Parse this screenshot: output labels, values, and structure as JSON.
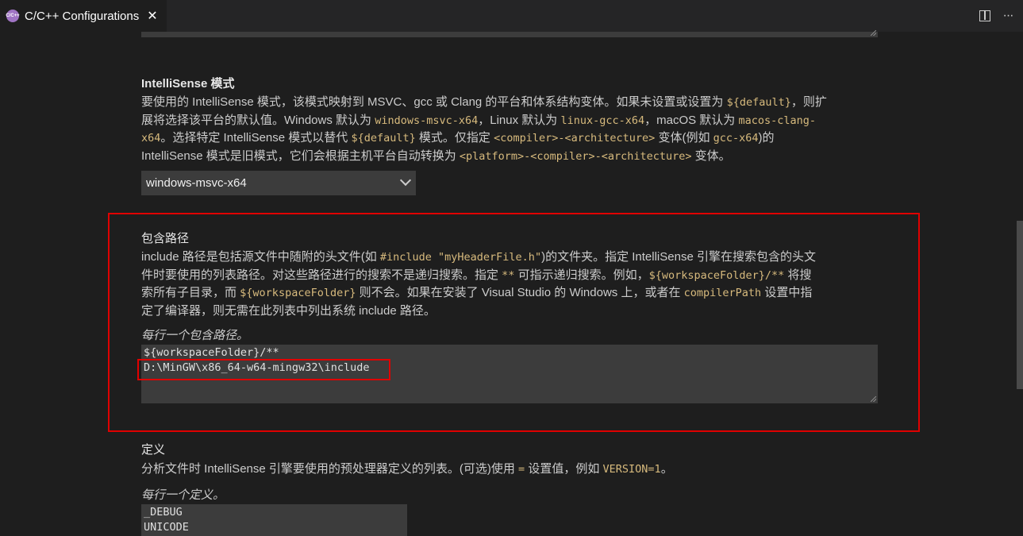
{
  "tab": {
    "title": "C/C++ Configurations",
    "icon": "c-cpp-file-icon",
    "icon_text": "C/C++",
    "close": "✕"
  },
  "toolbar": {
    "split_icon": "split-editor-icon",
    "more": "···"
  },
  "intellisense": {
    "heading": "IntelliSense 模式",
    "desc": [
      [
        {
          "t": "要使用的 IntelliSense 模式，该模式映射到 MSVC、gcc 或 Clang 的平台和体系结构变体。如果未设置或设置为 "
        },
        {
          "c": "${default}"
        },
        {
          "t": "，则扩"
        }
      ],
      [
        {
          "t": "展将选择该平台的默认值。Windows 默认为 "
        },
        {
          "c": "windows-msvc-x64"
        },
        {
          "t": "，Linux 默认为 "
        },
        {
          "c": "linux-gcc-x64"
        },
        {
          "t": "，macOS 默认为 "
        },
        {
          "c": "macos-clang-"
        }
      ],
      [
        {
          "c": "x64"
        },
        {
          "t": "。选择特定 IntelliSense 模式以替代 "
        },
        {
          "c": "${default}"
        },
        {
          "t": " 模式。仅指定 "
        },
        {
          "c": "<compiler>-<architecture>"
        },
        {
          "t": " 变体(例如 "
        },
        {
          "c": "gcc-x64"
        },
        {
          "t": ")的"
        }
      ],
      [
        {
          "t": "IntelliSense 模式是旧模式，它们会根据主机平台自动转换为 "
        },
        {
          "c": "<platform>-<compiler>-<architecture>"
        },
        {
          "t": " 变体。"
        }
      ]
    ],
    "selected": "windows-msvc-x64"
  },
  "include_path": {
    "heading": "包含路径",
    "desc": [
      [
        {
          "t": "include 路径是包括源文件中随附的头文件(如 "
        },
        {
          "c": "#include \"myHeaderFile.h\""
        },
        {
          "t": ")的文件夹。指定 IntelliSense 引擎在搜索包含的头文"
        }
      ],
      [
        {
          "t": "件时要使用的列表路径。对这些路径进行的搜索不是递归搜索。指定 "
        },
        {
          "c": "**"
        },
        {
          "t": " 可指示递归搜索。例如，"
        },
        {
          "c": "${workspaceFolder}/**"
        },
        {
          "t": " 将搜"
        }
      ],
      [
        {
          "t": "索所有子目录，而 "
        },
        {
          "c": "${workspaceFolder}"
        },
        {
          "t": " 则不会。如果在安装了 Visual Studio 的 Windows 上，或者在 "
        },
        {
          "c": "compilerPath"
        },
        {
          "t": " 设置中指"
        }
      ],
      [
        {
          "t": "定了编译器，则无需在此列表中列出系统 include 路径。"
        }
      ]
    ],
    "hint": "每行一个包含路径。",
    "lines": [
      "${workspaceFolder}/**",
      "D:\\MinGW\\x86_64-w64-mingw32\\include"
    ]
  },
  "defines": {
    "heading": "定义",
    "desc": [
      [
        {
          "t": "分析文件时 IntelliSense 引擎要使用的预处理器定义的列表。(可选)使用 "
        },
        {
          "c": "="
        },
        {
          "t": " 设置值，例如 "
        },
        {
          "c": "VERSION=1"
        },
        {
          "t": "。"
        }
      ]
    ],
    "hint": "每行一个定义。",
    "lines": [
      "_DEBUG",
      "UNICODE"
    ]
  },
  "colors": {
    "highlight_box": "#e00000",
    "code_text": "#d7ba7d",
    "background": "#1e1e1e"
  }
}
